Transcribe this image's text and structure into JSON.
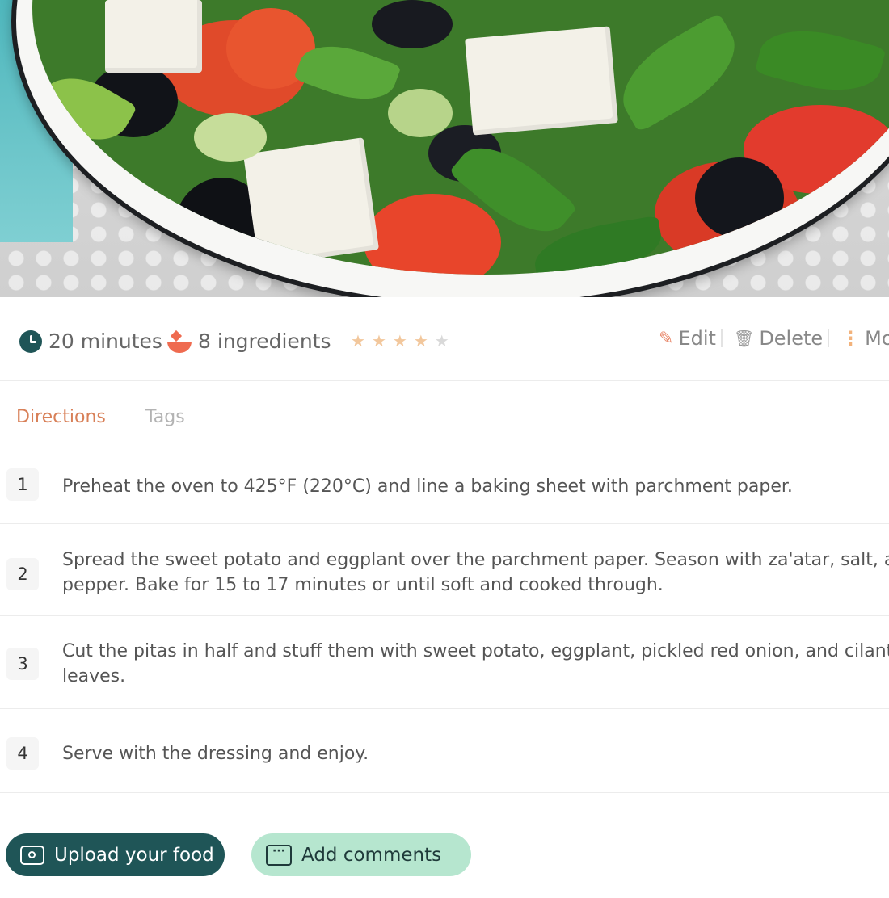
{
  "hero": {
    "image": "greek-salad-bowl-photo"
  },
  "meta": {
    "time_icon": "clock-icon",
    "time": "20 minutes",
    "ingredients_icon": "bowl-icon",
    "ingredients": "8 ingredients",
    "rating": {
      "value": 4,
      "max": 5
    },
    "actions": {
      "edit": "Edit",
      "delete": "Delete",
      "more": "Mor"
    },
    "colors": {
      "accent": "#d88058",
      "primary": "#1f5557",
      "star": "#f2c79c"
    }
  },
  "tabs": [
    {
      "label": "Directions",
      "active": true
    },
    {
      "label": "Tags",
      "active": false
    }
  ],
  "steps": [
    {
      "num": "1",
      "text": "Preheat the oven to 425°F (220°C) and line a baking sheet with parchment paper."
    },
    {
      "num": "2",
      "text": "Spread the sweet potato and eggplant over the  parchment paper. Season with za'atar, salt, a\npepper. Bake for 15 to 17 minutes or until soft and cooked through."
    },
    {
      "num": "3",
      "text": "Cut the pitas in half and stuff them with sweet potato, eggplant, pickled red onion, and cilantro\nleaves."
    },
    {
      "num": "4",
      "text": "Serve with the dressing and enjoy."
    }
  ],
  "buttons": {
    "upload": "Upload your food",
    "comment": "Add comments"
  }
}
